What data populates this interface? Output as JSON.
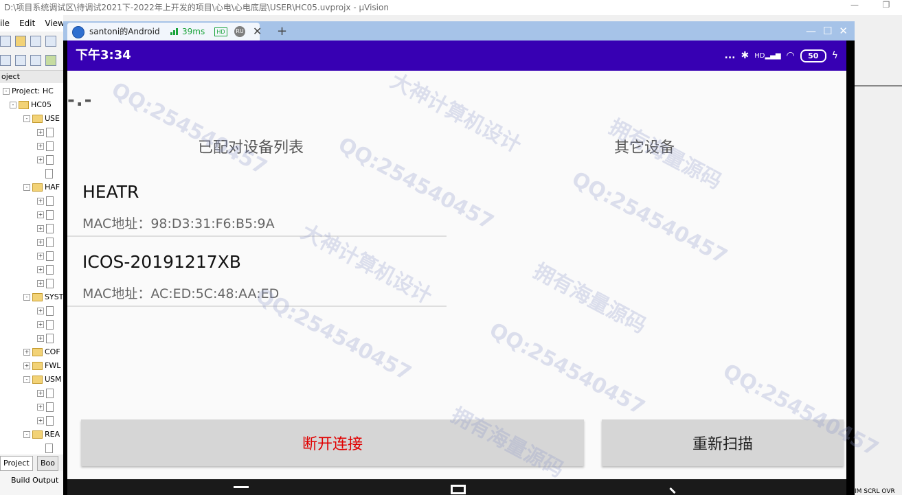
{
  "uvision": {
    "title": "D:\\项目系统调试区\\待调试2021下-2022年上开发的项目\\心电\\心电底层\\USER\\HC05.uvprojx - µVision",
    "menu": [
      "ile",
      "Edit",
      "View"
    ],
    "panel_header": "oject",
    "tree": {
      "project": "Project: HC",
      "target": "HC05",
      "groups": [
        "USE",
        "HAF",
        "SYST",
        "COF",
        "FWL",
        "USM",
        "REA"
      ]
    },
    "tabs": [
      "Project",
      "Boo"
    ],
    "build_output": "Build Output",
    "status_right": "IM SCRL OVR"
  },
  "scrcpy": {
    "device_name": "santoni的Android",
    "ping": "39ms",
    "hd_badge": "HD",
    "ru_badge": "RU",
    "close_glyph": "✕",
    "newtab_glyph": "+",
    "win_controls": [
      "—",
      "☐",
      "✕"
    ]
  },
  "android": {
    "status_time": "下午3:34",
    "status_dots": "...",
    "net_badge": "HD",
    "battery": "50",
    "connected_device": "-.-",
    "paired_header": "已配对设备列表",
    "other_header": "其它设备",
    "paired_devices": [
      {
        "name": "HEATR",
        "mac": "MAC地址：98:D3:31:F6:B5:9A"
      },
      {
        "name": "ICOS-20191217XB",
        "mac": "MAC地址：AC:ED:5C:48:AA:ED"
      }
    ],
    "disconnect_label": "断开连接",
    "rescan_label": "重新扫描",
    "colors": {
      "status_bar": "#3700b3",
      "disconnect_text": "#e00000"
    }
  },
  "watermark": {
    "qq": "QQ:254540457",
    "text1": "大神计算机设计",
    "text2": "拥有海量源码"
  }
}
